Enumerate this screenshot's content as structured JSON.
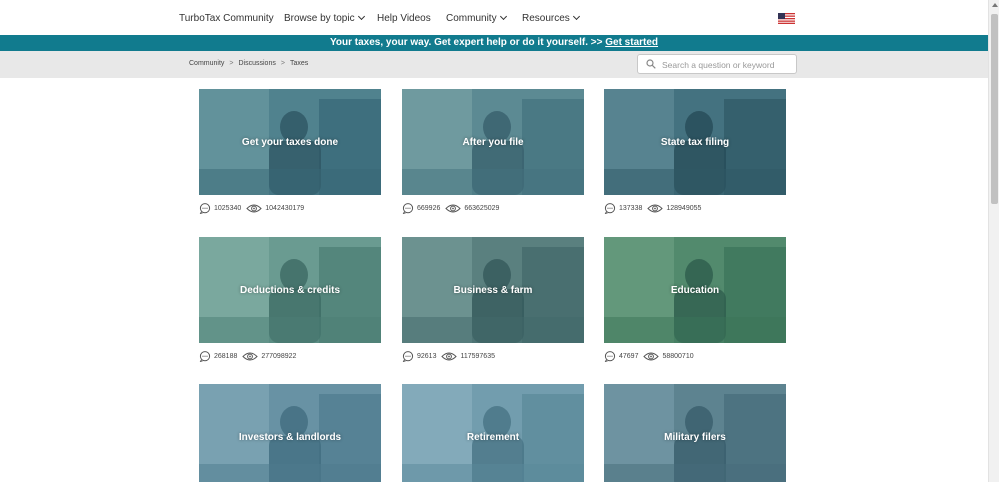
{
  "nav": {
    "brand": "TurboTax Community",
    "items": [
      {
        "label": "Browse by topic",
        "dropdown": true
      },
      {
        "label": "Help Videos",
        "dropdown": false
      },
      {
        "label": "Community",
        "dropdown": true
      },
      {
        "label": "Resources",
        "dropdown": true
      }
    ]
  },
  "promo": {
    "text": "Your taxes, your way. Get expert help or do it yourself. >> ",
    "link": "Get started"
  },
  "breadcrumb": [
    "Community",
    "Discussions",
    "Taxes"
  ],
  "search": {
    "placeholder": "Search a question or keyword"
  },
  "colors": {
    "accent": "#117b8e",
    "overlay": "#2a8aa8"
  },
  "cards": [
    {
      "title": "Get your taxes done",
      "replies": "1025340",
      "views": "1042430179",
      "scene": "tones-a"
    },
    {
      "title": "After you file",
      "replies": "669926",
      "views": "663625029",
      "scene": "tones-b"
    },
    {
      "title": "State tax filing",
      "replies": "137338",
      "views": "128949055",
      "scene": "tones-c"
    },
    {
      "title": "Deductions & credits",
      "replies": "268188",
      "views": "277098922",
      "scene": "tones-d"
    },
    {
      "title": "Business & farm",
      "replies": "92613",
      "views": "117597635",
      "scene": "tones-e"
    },
    {
      "title": "Education",
      "replies": "47697",
      "views": "58800710",
      "scene": "tones-f"
    },
    {
      "title": "Investors & landlords",
      "replies": "",
      "views": "",
      "scene": "tones-g"
    },
    {
      "title": "Retirement",
      "replies": "",
      "views": "",
      "scene": "tones-h"
    },
    {
      "title": "Military filers",
      "replies": "",
      "views": "",
      "scene": "tones-i"
    }
  ]
}
